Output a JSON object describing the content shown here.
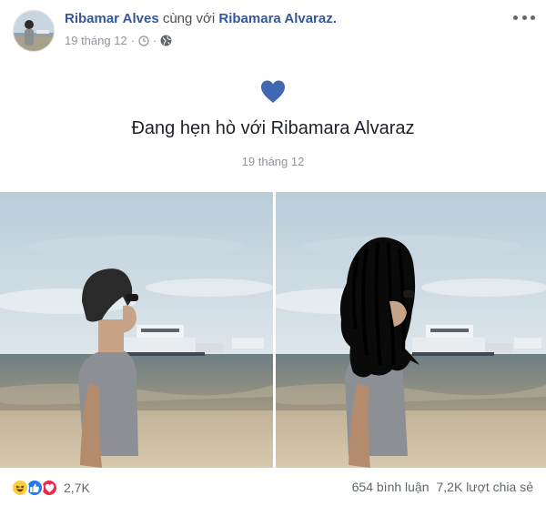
{
  "header": {
    "author_name": "Ribamar Alves",
    "with_text": "cùng với",
    "partner_name": "Ribamara Alvaraz",
    "period": ".",
    "date": "19 tháng 12",
    "separator": "·",
    "icons": [
      "clock-icon",
      "globe-icon",
      "more-options-icon"
    ]
  },
  "life_event": {
    "icon": "heart-icon",
    "title": "Đang hẹn hò với Ribamara Alvaraz",
    "date": "19 tháng 12"
  },
  "photos": [
    {
      "subject": "beach-photo-original"
    },
    {
      "subject": "beach-photo-edited-long-hair"
    }
  ],
  "footer": {
    "reaction_icons": [
      "haha-icon",
      "like-icon",
      "love-icon"
    ],
    "reaction_count": "2,7K",
    "comments": "654 bình luận",
    "shares": "7,2K lượt chia sẻ"
  },
  "colors": {
    "link": "#365899",
    "heart": "#4267b2",
    "meta": "#90949c",
    "like": "#2078f4",
    "love": "#f0284a",
    "haha": "#fbcd3f"
  }
}
